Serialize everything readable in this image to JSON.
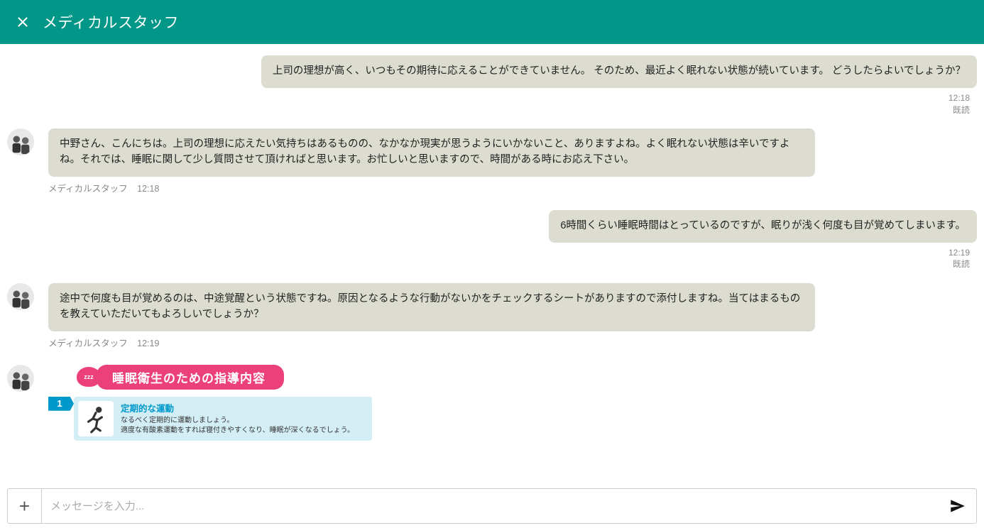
{
  "header": {
    "title": "メディカルスタッフ"
  },
  "messages": {
    "m1": {
      "text": "上司の理想が高く、いつもその期待に応えることができていません。 そのため、最近よく眠れない状態が続いています。 どうしたらよいでしょうか？",
      "time": "12:18",
      "read": "既読"
    },
    "m2": {
      "text": "中野さん、こんにちは。上司の理想に応えたい気持ちはあるものの、なかなか現実が思うようにいかないこと、ありますよね。よく眠れない状態は辛いですよね。それでは、睡眠に関して少し質問させて頂ければと思います。お忙しいと思いますので、時間がある時にお応え下さい。",
      "sender": "メディカルスタッフ",
      "time": "12:18"
    },
    "m3": {
      "text": "6時間くらい睡眠時間はとっているのですが、眠りが浅く何度も目が覚めてしまいます。",
      "time": "12:19",
      "read": "既読"
    },
    "m4": {
      "text": "途中で何度も目が覚めるのは、中途覚醒という状態ですね。原因となるような行動がないかをチェックするシートがありますので添付しますね。当てはまるものを教えていただいてもよろしいでしょうか？",
      "sender": "メディカルスタッフ",
      "time": "12:19"
    }
  },
  "attachment": {
    "zzz": "zzz",
    "header": "睡眠衛生のための指導内容",
    "item_num": "1",
    "item_title": "定期的な運動",
    "item_line1": "なるべく定期的に運動しましょう。",
    "item_line2": "適度な有酸素運動をすれば寝付きやすくなり、睡眠が深くなるでしょう。"
  },
  "composer": {
    "placeholder": "メッセージを入力..."
  }
}
